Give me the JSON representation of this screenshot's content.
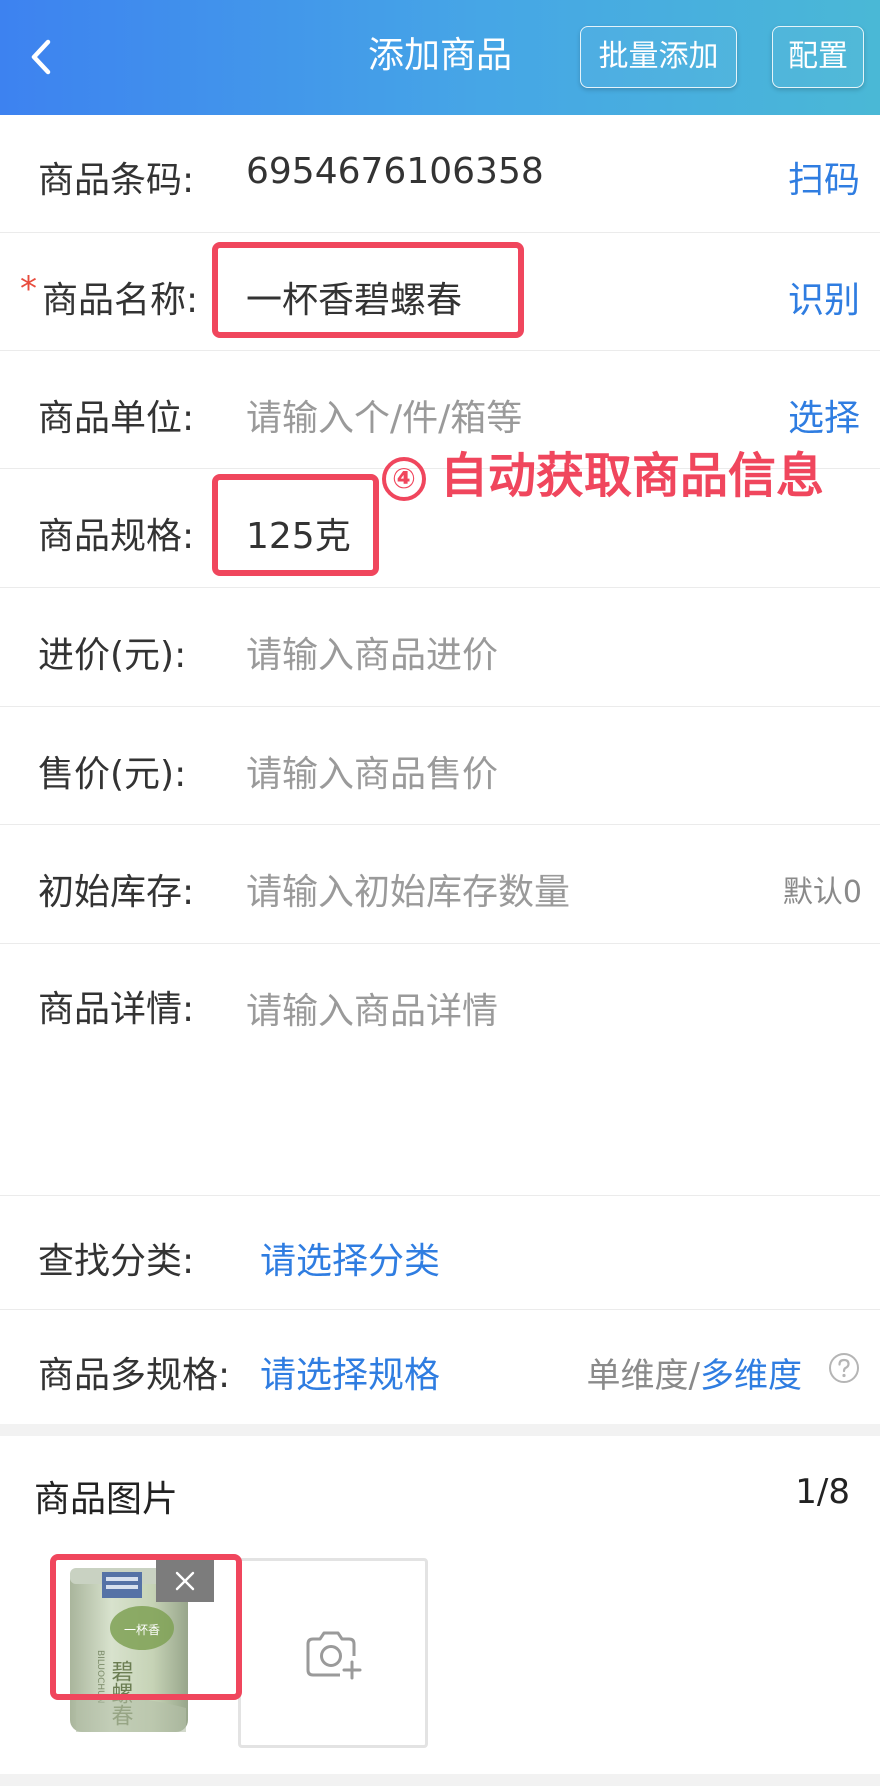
{
  "header": {
    "title": "添加商品",
    "batch_add_label": "批量添加",
    "config_label": "配置"
  },
  "form": {
    "barcode": {
      "label": "商品条码:",
      "value": "6954676106358",
      "action": "扫码"
    },
    "name": {
      "required_mark": "*",
      "label": "商品名称:",
      "value": "一杯香碧螺春",
      "action": "识别"
    },
    "unit": {
      "label": "商品单位:",
      "placeholder": "请输入个/件/箱等",
      "action": "选择"
    },
    "spec": {
      "label": "商品规格:",
      "value": "125克"
    },
    "purchase_price": {
      "label": "进价(元):",
      "placeholder": "请输入商品进价"
    },
    "sale_price": {
      "label": "售价(元):",
      "placeholder": "请输入商品售价"
    },
    "initial_stock": {
      "label": "初始库存:",
      "placeholder": "请输入初始库存数量",
      "hint": "默认0"
    },
    "details": {
      "label": "商品详情:",
      "placeholder": "请输入商品详情"
    },
    "category": {
      "label": "查找分类:",
      "action": "请选择分类"
    },
    "multi_spec": {
      "label": "商品多规格:",
      "action": "请选择规格",
      "single_dim": "单维度/",
      "multi_dim": "多维度"
    }
  },
  "annotation": {
    "number": "④",
    "text": "自动获取商品信息"
  },
  "images": {
    "title": "商品图片",
    "count": "1/8"
  },
  "product_photo_text": {
    "brand": "一杯香",
    "name_cn": "碧螺春",
    "name_en": "BILUOCHUN"
  },
  "colors": {
    "primary": "#2f7de1",
    "annotation": "#f0465d",
    "header_start": "#3d82f0",
    "header_end": "#4ab8d6"
  }
}
